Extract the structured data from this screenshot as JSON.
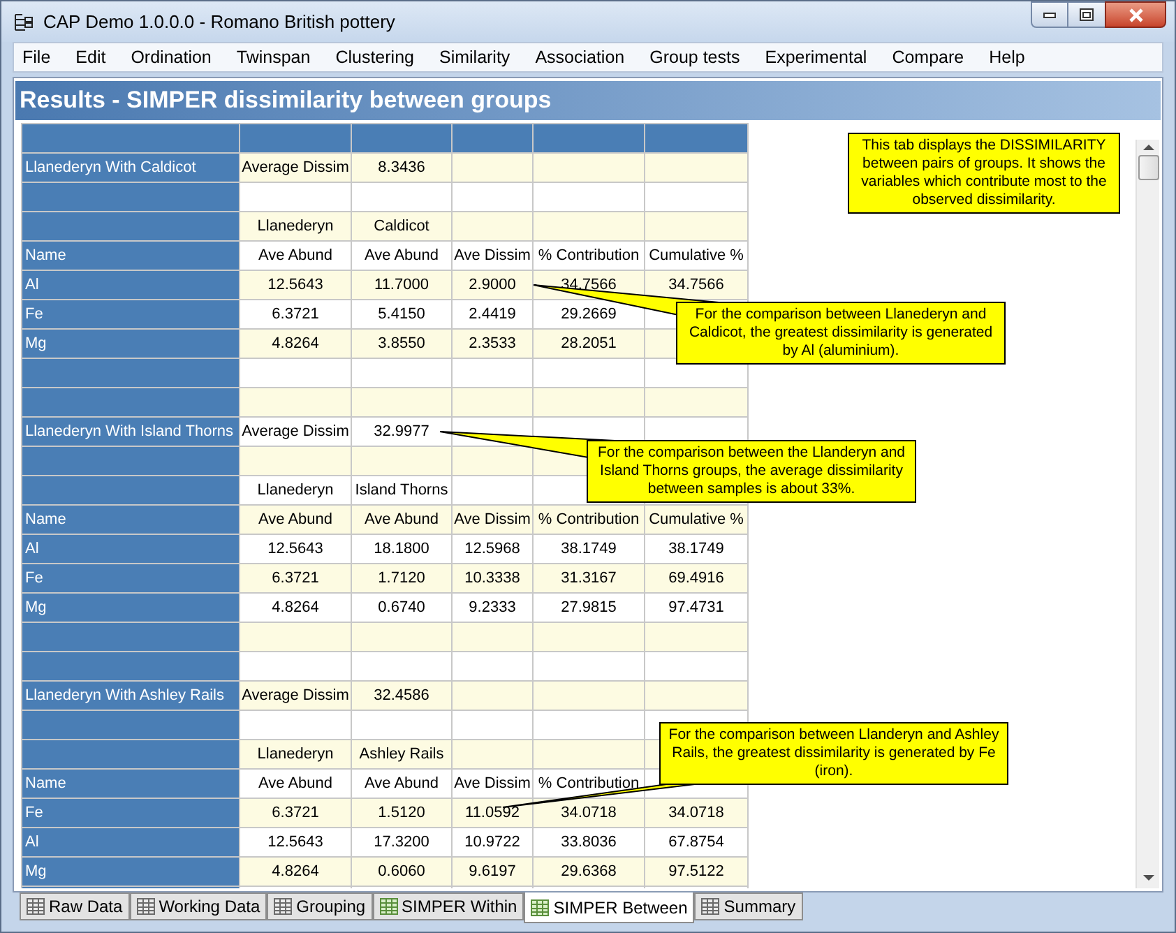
{
  "window": {
    "title": "CAP Demo 1.0.0.0 - Romano British pottery"
  },
  "menu": [
    "File",
    "Edit",
    "Ordination",
    "Twinspan",
    "Clustering",
    "Similarity",
    "Association",
    "Group tests",
    "Experimental",
    "Compare",
    "Help"
  ],
  "panel": {
    "title": "Results - SIMPER dissimilarity between groups"
  },
  "grid": {
    "rows": [
      {
        "kind": "header"
      },
      {
        "kind": "data",
        "label": "Llanederyn With Caldicot",
        "cells": [
          "Average Dissim",
          "8.3436",
          null,
          null,
          null
        ]
      },
      {
        "kind": "blank"
      },
      {
        "kind": "data",
        "cells": [
          "Llanederyn",
          "Caldicot",
          null,
          null,
          null
        ]
      },
      {
        "kind": "data",
        "label": "Name",
        "cells": [
          "Ave Abund",
          "Ave Abund",
          "Ave Dissim",
          "% Contribution",
          "Cumulative %"
        ]
      },
      {
        "kind": "data",
        "label": "Al",
        "cells": [
          "12.5643",
          "11.7000",
          "2.9000",
          "34.7566",
          "34.7566"
        ]
      },
      {
        "kind": "data",
        "label": "Fe",
        "cells": [
          "6.3721",
          "5.4150",
          "2.4419",
          "29.2669",
          null
        ]
      },
      {
        "kind": "data",
        "label": "Mg",
        "cells": [
          "4.8264",
          "3.8550",
          "2.3533",
          "28.2051",
          null
        ]
      },
      {
        "kind": "blank"
      },
      {
        "kind": "blank"
      },
      {
        "kind": "data",
        "label": "Llanederyn With Island Thorns",
        "cells": [
          "Average Dissim",
          "32.9977",
          null,
          null,
          null
        ]
      },
      {
        "kind": "blank"
      },
      {
        "kind": "data",
        "cells": [
          "Llanederyn",
          "Island Thorns",
          null,
          null,
          null
        ]
      },
      {
        "kind": "data",
        "label": "Name",
        "cells": [
          "Ave Abund",
          "Ave Abund",
          "Ave Dissim",
          "% Contribution",
          "Cumulative %"
        ]
      },
      {
        "kind": "data",
        "label": "Al",
        "cells": [
          "12.5643",
          "18.1800",
          "12.5968",
          "38.1749",
          "38.1749"
        ]
      },
      {
        "kind": "data",
        "label": "Fe",
        "cells": [
          "6.3721",
          "1.7120",
          "10.3338",
          "31.3167",
          "69.4916"
        ]
      },
      {
        "kind": "data",
        "label": "Mg",
        "cells": [
          "4.8264",
          "0.6740",
          "9.2333",
          "27.9815",
          "97.4731"
        ]
      },
      {
        "kind": "blank"
      },
      {
        "kind": "blank"
      },
      {
        "kind": "data",
        "label": "Llanederyn With Ashley Rails",
        "cells": [
          "Average Dissim",
          "32.4586",
          null,
          null,
          null
        ]
      },
      {
        "kind": "blank"
      },
      {
        "kind": "data",
        "cells": [
          "Llanederyn",
          "Ashley Rails",
          null,
          null,
          null
        ]
      },
      {
        "kind": "data",
        "label": "Name",
        "cells": [
          "Ave Abund",
          "Ave Abund",
          "Ave Dissim",
          "% Contribution",
          null
        ]
      },
      {
        "kind": "data",
        "label": "Fe",
        "cells": [
          "6.3721",
          "1.5120",
          "11.0592",
          "34.0718",
          "34.0718"
        ]
      },
      {
        "kind": "data",
        "label": "Al",
        "cells": [
          "12.5643",
          "17.3200",
          "10.9722",
          "33.8036",
          "67.8754"
        ]
      },
      {
        "kind": "data",
        "label": "Mg",
        "cells": [
          "4.8264",
          "0.6060",
          "9.6197",
          "29.6368",
          "97.5122"
        ]
      },
      {
        "kind": "blank"
      }
    ]
  },
  "notes": [
    {
      "kind": "info",
      "text": "This tab displays the DISSIMILARITY between pairs of groups. It shows the variables which contribute most to the observed dissimilarity."
    },
    {
      "kind": "callout",
      "text": "For the comparison between Llanederyn and Caldicot, the greatest dissimilarity is generated by Al (aluminium)."
    },
    {
      "kind": "callout",
      "text": "For the comparison between the Llanderyn and Island Thorns groups, the average dissimilarity between samples is about 33%."
    },
    {
      "kind": "callout",
      "text": "For the comparison between Llanderyn and Ashley Rails, the greatest dissimilarity is generated by Fe (iron)."
    }
  ],
  "tabs": [
    {
      "label": "Raw Data",
      "selected": false
    },
    {
      "label": "Working Data",
      "selected": false
    },
    {
      "label": "Grouping",
      "selected": false
    },
    {
      "label": "SIMPER Within",
      "selected": false
    },
    {
      "label": "SIMPER Between",
      "selected": true
    },
    {
      "label": "Summary",
      "selected": false
    }
  ]
}
